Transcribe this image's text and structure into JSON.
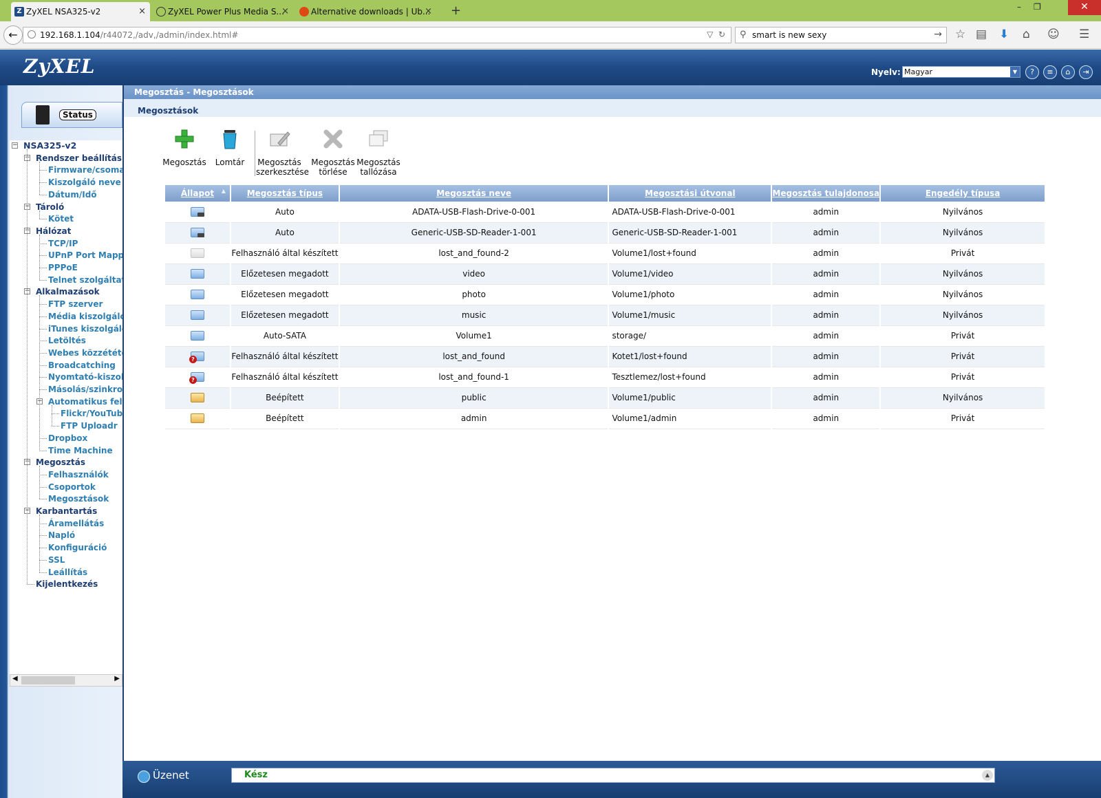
{
  "browser": {
    "tabs": [
      {
        "title": "ZyXEL NSA325-v2",
        "favicon": "Z",
        "active": true
      },
      {
        "title": "ZyXEL Power Plus Media S...",
        "favicon": "chat-icon",
        "active": false
      },
      {
        "title": "Alternative downloads | Ub...",
        "favicon": "ubuntu-icon",
        "active": false
      }
    ],
    "close_glyph": "×",
    "new_tab_glyph": "+",
    "window_buttons": [
      "–",
      "❐",
      "✕"
    ],
    "url_host": "192.168.1.104",
    "url_path": "/r44072,/adv,/admin/index.html#",
    "search_value": "smart is new sexy"
  },
  "app": {
    "logo": "ZyXEL",
    "language_label": "Nyelv:",
    "language_value": "Magyar",
    "header_icons": [
      "help-icon",
      "notes-icon",
      "home-icon",
      "logout-icon"
    ]
  },
  "sidebar": {
    "status_label": "Status",
    "tree": [
      {
        "label": "NSA325-v2",
        "level": 0,
        "expandable": true
      },
      {
        "label": "Rendszer beállítás",
        "level": 1,
        "expandable": true
      },
      {
        "label": "Firmware/csomag",
        "level": 2
      },
      {
        "label": "Kiszolgáló neve",
        "level": 2
      },
      {
        "label": "Dátum/Idő",
        "level": 2
      },
      {
        "label": "Tároló",
        "level": 1,
        "expandable": true
      },
      {
        "label": "Kötet",
        "level": 2
      },
      {
        "label": "Hálózat",
        "level": 1,
        "expandable": true
      },
      {
        "label": "TCP/IP",
        "level": 2
      },
      {
        "label": "UPnP Port Mapping",
        "level": 2
      },
      {
        "label": "PPPoE",
        "level": 2
      },
      {
        "label": "Telnet szolgáltatás",
        "level": 2
      },
      {
        "label": "Alkalmazások",
        "level": 1,
        "expandable": true
      },
      {
        "label": "FTP szerver",
        "level": 2
      },
      {
        "label": "Média kiszolgáló",
        "level": 2
      },
      {
        "label": "iTunes kiszolgáló",
        "level": 2
      },
      {
        "label": "Letöltés",
        "level": 2
      },
      {
        "label": "Webes közzététel",
        "level": 2
      },
      {
        "label": "Broadcatching",
        "level": 2
      },
      {
        "label": "Nyomtató-kiszolgáló",
        "level": 2
      },
      {
        "label": "Másolás/szinkronizálás",
        "level": 2
      },
      {
        "label": "Automatikus feltöltés",
        "level": 2,
        "expandable": true
      },
      {
        "label": "Flickr/YouTube",
        "level": 3
      },
      {
        "label": "FTP Uploadr",
        "level": 3
      },
      {
        "label": "Dropbox",
        "level": 2
      },
      {
        "label": "Time Machine",
        "level": 2
      },
      {
        "label": "Megosztás",
        "level": 1,
        "expandable": true
      },
      {
        "label": "Felhasználók",
        "level": 2
      },
      {
        "label": "Csoportok",
        "level": 2
      },
      {
        "label": "Megosztások",
        "level": 2
      },
      {
        "label": "Karbantartás",
        "level": 1,
        "expandable": true
      },
      {
        "label": "Áramellátás",
        "level": 2
      },
      {
        "label": "Napló",
        "level": 2
      },
      {
        "label": "Konfiguráció",
        "level": 2
      },
      {
        "label": "SSL",
        "level": 2
      },
      {
        "label": "Leállítás",
        "level": 2
      },
      {
        "label": "Kijelentkezés",
        "level": 1
      }
    ]
  },
  "main": {
    "breadcrumb": "Megosztás - Megosztások",
    "subheader": "Megosztások",
    "toolbar": [
      {
        "label": "Megosztás",
        "icon": "add-icon"
      },
      {
        "label": "Lomtár",
        "icon": "recycle-bin-icon"
      },
      {
        "label": "Megosztás szerkesztése",
        "icon": "edit-share-icon"
      },
      {
        "label": "Megosztás törlése",
        "icon": "delete-share-icon"
      },
      {
        "label": "Megosztás tallózása",
        "icon": "browse-share-icon"
      }
    ],
    "columns": [
      "Állapot",
      "Megosztás típus",
      "Megosztás neve",
      "Megosztási útvonal",
      "Megosztás tulajdonosa",
      "Engedély típusa"
    ],
    "rows": [
      {
        "icon": "usb-share-icon",
        "type": "Auto",
        "name": "ADATA-USB-Flash-Drive-0-001",
        "path": "ADATA-USB-Flash-Drive-0-001",
        "owner": "admin",
        "permission": "Nyilvános"
      },
      {
        "icon": "usb-share-icon",
        "type": "Auto",
        "name": "Generic-USB-SD-Reader-1-001",
        "path": "Generic-USB-SD-Reader-1-001",
        "owner": "admin",
        "permission": "Nyilvános"
      },
      {
        "icon": "disabled-share-icon",
        "type": "Felhasználó által készített",
        "name": "lost_and_found-2",
        "path": "Volume1/lost+found",
        "owner": "admin",
        "permission": "Privát"
      },
      {
        "icon": "share-icon",
        "type": "Előzetesen megadott",
        "name": "video",
        "path": "Volume1/video",
        "owner": "admin",
        "permission": "Nyilvános"
      },
      {
        "icon": "share-icon",
        "type": "Előzetesen megadott",
        "name": "photo",
        "path": "Volume1/photo",
        "owner": "admin",
        "permission": "Nyilvános"
      },
      {
        "icon": "share-icon",
        "type": "Előzetesen megadott",
        "name": "music",
        "path": "Volume1/music",
        "owner": "admin",
        "permission": "Nyilvános"
      },
      {
        "icon": "share-icon",
        "type": "Auto-SATA",
        "name": "Volume1",
        "path": "storage/",
        "owner": "admin",
        "permission": "Privát"
      },
      {
        "icon": "missing-share-icon",
        "type": "Felhasználó által készített",
        "name": "lost_and_found",
        "path": "Kotet1/lost+found",
        "owner": "admin",
        "permission": "Privát"
      },
      {
        "icon": "missing-share-icon",
        "type": "Felhasználó által készített",
        "name": "lost_and_found-1",
        "path": "Tesztlemez/lost+found",
        "owner": "admin",
        "permission": "Privát"
      },
      {
        "icon": "builtin-share-icon",
        "type": "Beépített",
        "name": "public",
        "path": "Volume1/public",
        "owner": "admin",
        "permission": "Nyilvános"
      },
      {
        "icon": "builtin-share-icon",
        "type": "Beépített",
        "name": "admin",
        "path": "Volume1/admin",
        "owner": "admin",
        "permission": "Privát"
      }
    ]
  },
  "statusbar": {
    "label": "Üzenet",
    "message": "Kész"
  }
}
